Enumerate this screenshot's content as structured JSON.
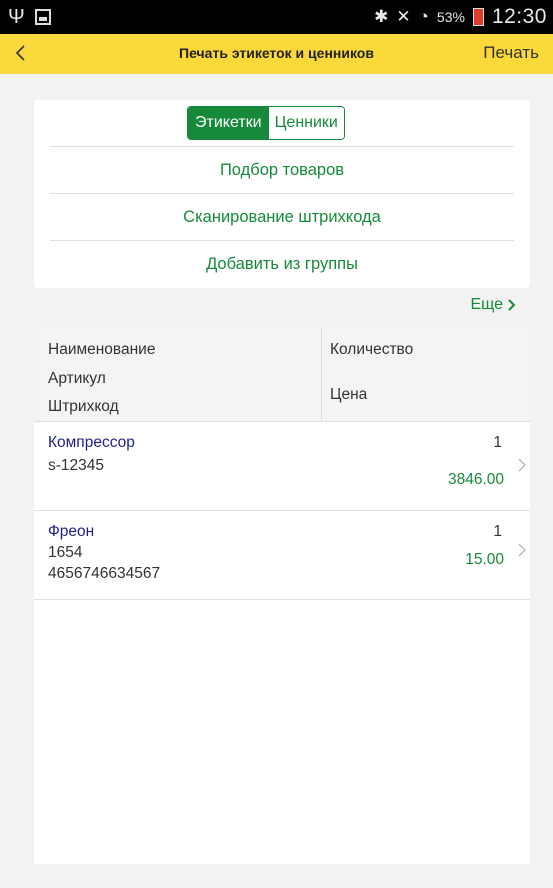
{
  "status_bar": {
    "usb_icon": "usb-icon",
    "battery_percent": "53%",
    "time": "12:30"
  },
  "header": {
    "back_icon": "chevron-left-icon",
    "title": "Печать этикеток и ценников",
    "print_label": "Печать",
    "color": "#fbd93a"
  },
  "actions": {
    "tabs": [
      {
        "label": "Этикетки",
        "selected": true
      },
      {
        "label": "Ценники",
        "selected": false
      }
    ],
    "items": [
      {
        "label": "Подбор товаров"
      },
      {
        "label": "Сканирование штрихкода"
      },
      {
        "label": "Добавить из группы"
      }
    ]
  },
  "more_label": "Еще",
  "table": {
    "headers": {
      "name": "Наименование",
      "article": "Артикул",
      "barcode": "Штрихкод",
      "quantity": "Количество",
      "price": "Цена"
    },
    "rows": [
      {
        "name": "Компрессор",
        "article": "s-12345",
        "barcode": "",
        "quantity": "1",
        "price": "3846.00"
      },
      {
        "name": "Фреон",
        "article": "1654",
        "barcode": "4656746634567",
        "quantity": "1",
        "price": "15.00"
      }
    ]
  },
  "colors": {
    "accent_green": "#168a3a",
    "link_blue": "#1f1f8c",
    "background": "#f2f2f2"
  }
}
